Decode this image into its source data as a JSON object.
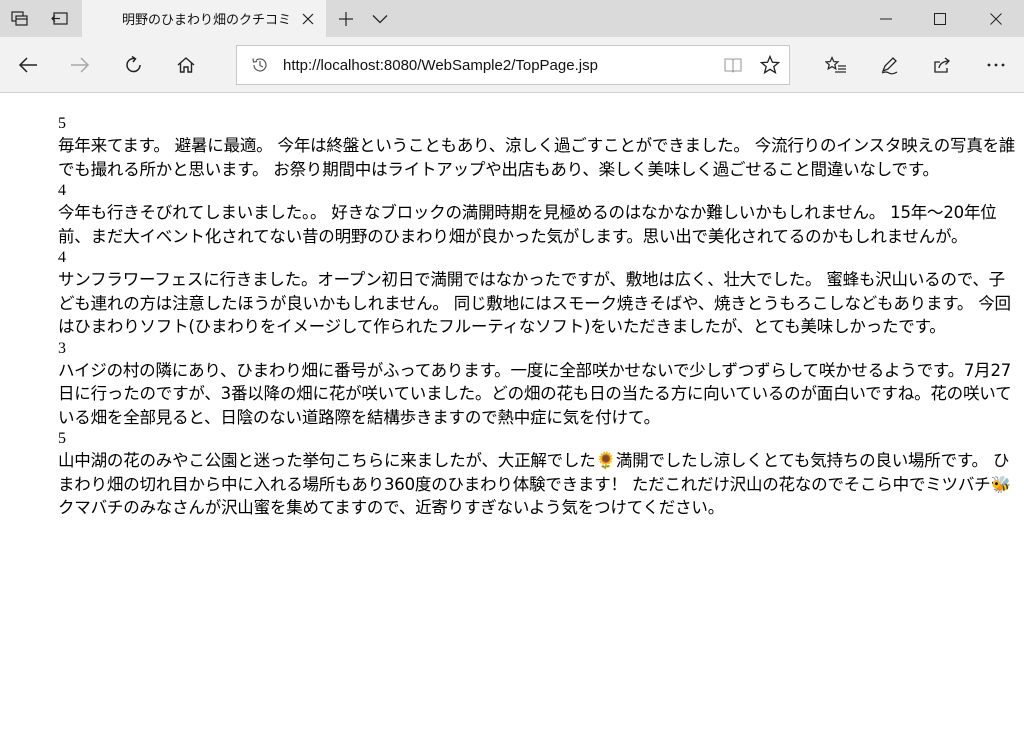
{
  "browser": {
    "tab_title": "明野のひまわり畑のクチコミ",
    "url": "http://localhost:8080/WebSample2/TopPage.jsp"
  },
  "reviews": [
    {
      "rating": "5",
      "comment": "毎年来てます。 避暑に最適。 今年は終盤ということもあり、涼しく過ごすことができました。 今流行りのインスタ映えの写真を誰でも撮れる所かと思います。 お祭り期間中はライトアップや出店もあり、楽しく美味しく過ごせること間違いなしです。"
    },
    {
      "rating": "4",
      "comment": "今年も行きそびれてしまいました。。 好きなブロックの満開時期を見極めるのはなかなか難しいかもしれません。 15年〜20年位前、まだ大イベント化されてない昔の明野のひまわり畑が良かった気がします。思い出で美化されてるのかもしれませんが。"
    },
    {
      "rating": "4",
      "comment": "サンフラワーフェスに行きました。オープン初日で満開ではなかったですが、敷地は広く、壮大でした。 蜜蜂も沢山いるので、子ども連れの方は注意したほうが良いかもしれません。 同じ敷地にはスモーク焼きそばや、焼きとうもろこしなどもあります。 今回はひまわりソフト(ひまわりをイメージして作られたフルーティなソフト)をいただきましたが、とても美味しかったです。"
    },
    {
      "rating": "3",
      "comment": "ハイジの村の隣にあり、ひまわり畑に番号がふってあります。一度に全部咲かせないで少しずつずらして咲かせるようです。7月27日に行ったのですが、3番以降の畑に花が咲いていました。どの畑の花も日の当たる方に向いているのが面白いですね。花の咲いている畑を全部見ると、日陰のない道路際を結構歩きますので熱中症に気を付けて。"
    },
    {
      "rating": "5",
      "comment": "山中湖の花のみやこ公園と迷った挙句こちらに来ましたが、大正解でした🌻満開でしたし涼しくとても気持ちの良い場所です。 ひまわり畑の切れ目から中に入れる場所もあり360度のひまわり体験できます！ ただこれだけ沢山の花なのでそこら中でミツバチ🐝クマバチのみなさんが沢山蜜を集めてますので、近寄りすぎないよう気をつけてください。"
    }
  ],
  "icons": {
    "tab_actions": "tab-actions-icon",
    "set_aside": "set-aside-icon",
    "close": "close-icon",
    "new_tab": "plus-icon",
    "tab_menu": "chevron-down-icon",
    "minimize": "minimize-icon",
    "maximize": "maximize-icon",
    "window_close": "close-icon",
    "back": "back-arrow-icon",
    "forward": "forward-arrow-icon",
    "refresh": "refresh-icon",
    "home": "home-icon",
    "history": "history-icon",
    "reading_view": "book-icon",
    "favorite": "star-icon",
    "favorites_list": "favorites-list-icon",
    "notes": "pen-icon",
    "share": "share-icon",
    "more": "more-icon"
  }
}
